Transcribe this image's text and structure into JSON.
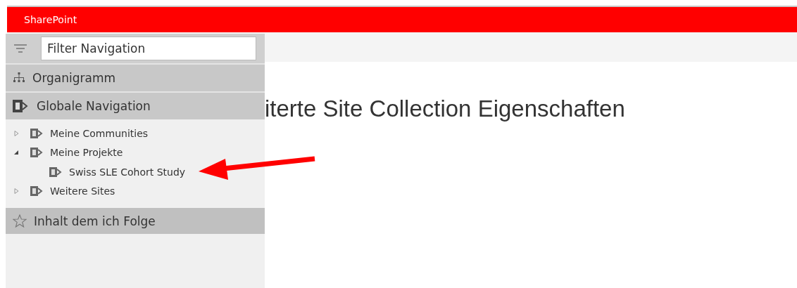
{
  "top_bar": {
    "title": "SharePoint"
  },
  "page": {
    "title": "iterte Site Collection Eigenschaften"
  },
  "navigation_panel": {
    "filter": {
      "placeholder": "Filter Navigation"
    },
    "headers": [
      {
        "label": "Organigramm",
        "kind": "org"
      },
      {
        "label": "Globale Navigation",
        "kind": "site"
      }
    ],
    "tree": [
      {
        "label": "Meine Communities",
        "expanded": false
      },
      {
        "label": "Meine Projekte",
        "expanded": true,
        "children": [
          {
            "label": "Swiss SLE Cohort Study"
          }
        ]
      },
      {
        "label": "Weitere Sites",
        "expanded": false
      }
    ],
    "footer": {
      "label": "Inhalt dem ich Folge"
    }
  }
}
